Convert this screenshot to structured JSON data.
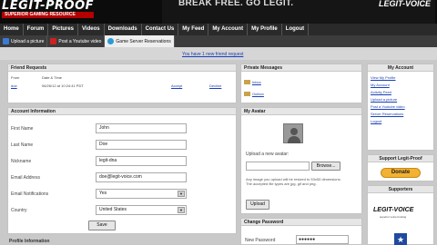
{
  "header": {
    "logo_main": "LEGIT-PROOF",
    "logo_tagline": "SUPERIOR GAMING RESOURCE",
    "banner_text": "BREAK FREE. GO LEGIT.",
    "banner_brand": "LEGIT-VOICE"
  },
  "nav": {
    "items": [
      "Home",
      "Forum",
      "Pictures",
      "Videos",
      "Downloads",
      "Contact Us",
      "My Feed",
      "My Account",
      "My Profile",
      "Logout"
    ]
  },
  "toolbar": {
    "items": [
      {
        "label": "Upload a picture",
        "icon": "picture-icon",
        "color": "#3a7bd5"
      },
      {
        "label": "Post a Youtube video",
        "icon": "youtube-icon",
        "color": "#cc2222"
      },
      {
        "label": "Game Server Reservations",
        "icon": "gamepad-icon",
        "color": "#2a9ad5"
      }
    ]
  },
  "notice": "You have 1 new friend request",
  "friend_requests": {
    "title": "Friend Requests",
    "headers": {
      "from": "From",
      "date": "Date & Time"
    },
    "rows": [
      {
        "from": "doe",
        "date": "06/26/12 at 10:24:41 PDT",
        "accept": "Accept",
        "decline": "Decline"
      }
    ]
  },
  "account_info": {
    "title": "Account Information",
    "fields": [
      {
        "label": "First Name",
        "value": "John"
      },
      {
        "label": "Last Name",
        "value": "Doe"
      },
      {
        "label": "Nickname",
        "value": "legit-dna"
      },
      {
        "label": "Email Address",
        "value": "doe@legit-voice.com"
      }
    ],
    "selects": [
      {
        "label": "Email Notifications",
        "value": "Yes"
      },
      {
        "label": "Country",
        "value": "United States"
      }
    ],
    "save_label": "Save"
  },
  "profile_info_title": "Profile Information",
  "private_messages": {
    "title": "Private Messages",
    "items": [
      "Inbox",
      "Outbox"
    ]
  },
  "avatar": {
    "title": "My Avatar",
    "upload_label": "Upload a new avatar:",
    "browse_label": "Browse...",
    "help": "Any image you upload will be resized to 53x53 dimensions. The accepted file types are jpg, gif and png.",
    "upload_button": "Upload"
  },
  "change_password": {
    "title": "Change Password",
    "label": "New Password",
    "value": "●●●●●●"
  },
  "my_account": {
    "title": "My Account",
    "links": [
      "View My Profile",
      "My Account",
      "Activity Feed",
      "Upload a picture",
      "Post a Youtube video",
      "Server Reservations",
      "Logout"
    ]
  },
  "support": {
    "title": "Support Legit-Proof",
    "donate_label": "Donate"
  },
  "supporters": {
    "title": "Supporters",
    "brand": "LEGIT-VOICE",
    "brand_sub": "superior voice hosting"
  }
}
